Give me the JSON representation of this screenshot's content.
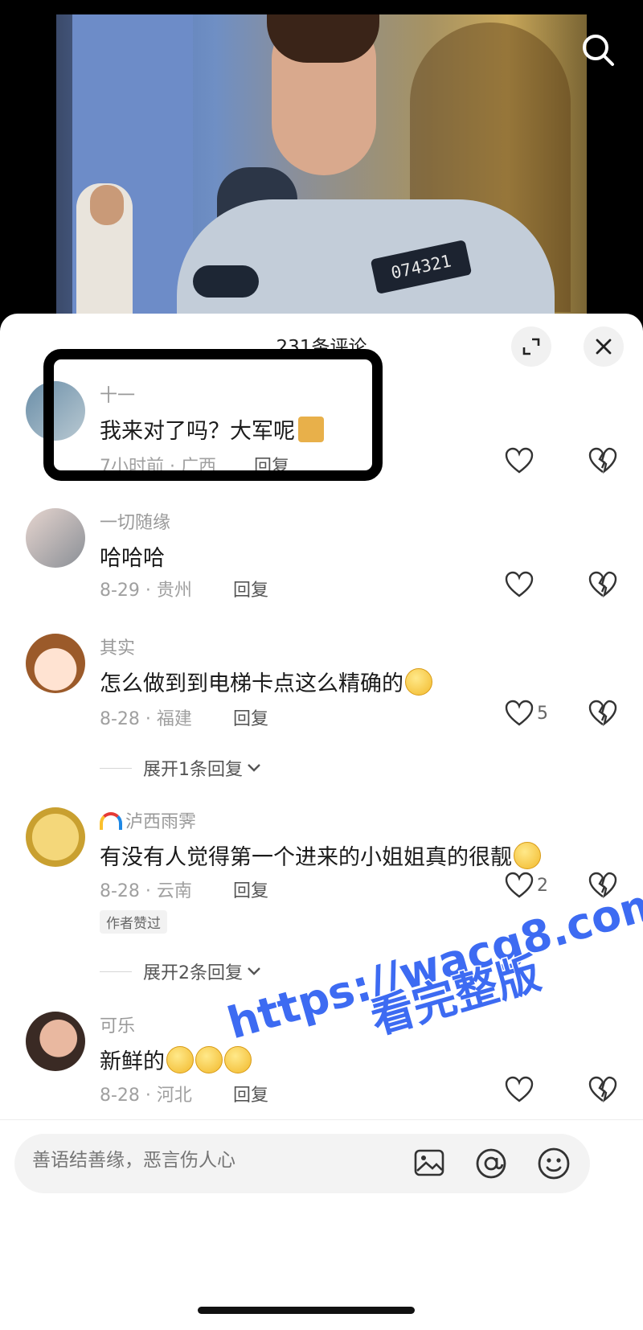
{
  "header": {
    "comment_count_title": "231条评论"
  },
  "video": {
    "badge_number": "074321"
  },
  "comments": [
    {
      "name": "十一",
      "text": "我来对了吗？大军呢",
      "date": "7小时前",
      "region": "广西",
      "reply_label": "回复",
      "likes": ""
    },
    {
      "name": "一切随缘",
      "text": "哈哈哈",
      "date": "8-29",
      "region": "贵州",
      "reply_label": "回复",
      "likes": ""
    },
    {
      "name": "其实",
      "text": "怎么做到到电梯卡点这么精确的",
      "date": "8-28",
      "region": "福建",
      "reply_label": "回复",
      "likes": "5",
      "expand_label": "展开1条回复"
    },
    {
      "name": "泸西雨霁",
      "text": "有没有人觉得第一个进来的小姐姐真的很靓",
      "date": "8-28",
      "region": "云南",
      "reply_label": "回复",
      "likes": "2",
      "author_liked": "作者赞过",
      "expand_label": "展开2条回复"
    },
    {
      "name": "可乐",
      "text": "新鲜的",
      "date": "8-28",
      "region": "河北",
      "reply_label": "回复",
      "likes": ""
    }
  ],
  "input": {
    "placeholder": "善语结善缘，恶言伤人心"
  },
  "watermark": {
    "line1": "https://wacg8.com",
    "line2": "看完整版",
    "color": "#3d6bf2"
  },
  "icons": [
    "search-icon",
    "expand-icon",
    "close-icon",
    "heart-icon",
    "broken-heart-icon",
    "image-icon",
    "at-icon",
    "emoji-icon"
  ]
}
